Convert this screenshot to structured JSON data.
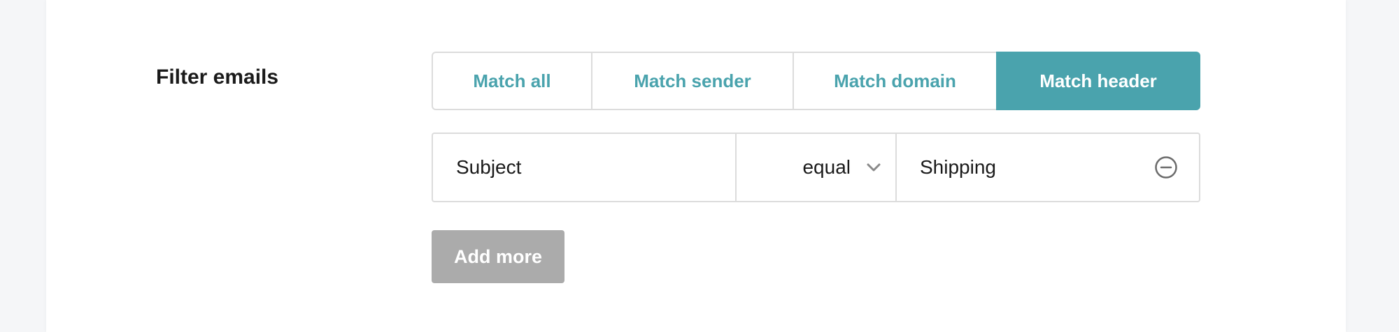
{
  "filter": {
    "label": "Filter emails",
    "modes": [
      {
        "label": "Match all",
        "active": false
      },
      {
        "label": "Match sender",
        "active": false
      },
      {
        "label": "Match domain",
        "active": false
      },
      {
        "label": "Match header",
        "active": true
      }
    ],
    "rule": {
      "field": "Subject",
      "operator": "equal",
      "value": "Shipping"
    },
    "add_more_label": "Add more"
  },
  "icons": {
    "operator_dropdown": "chevron-down-icon",
    "remove_rule": "minus-circle-icon"
  },
  "colors": {
    "accent": "#4aa3ad",
    "border": "#dcdcdc",
    "disabled_button": "#ababab",
    "background": "#f5f6f8"
  }
}
